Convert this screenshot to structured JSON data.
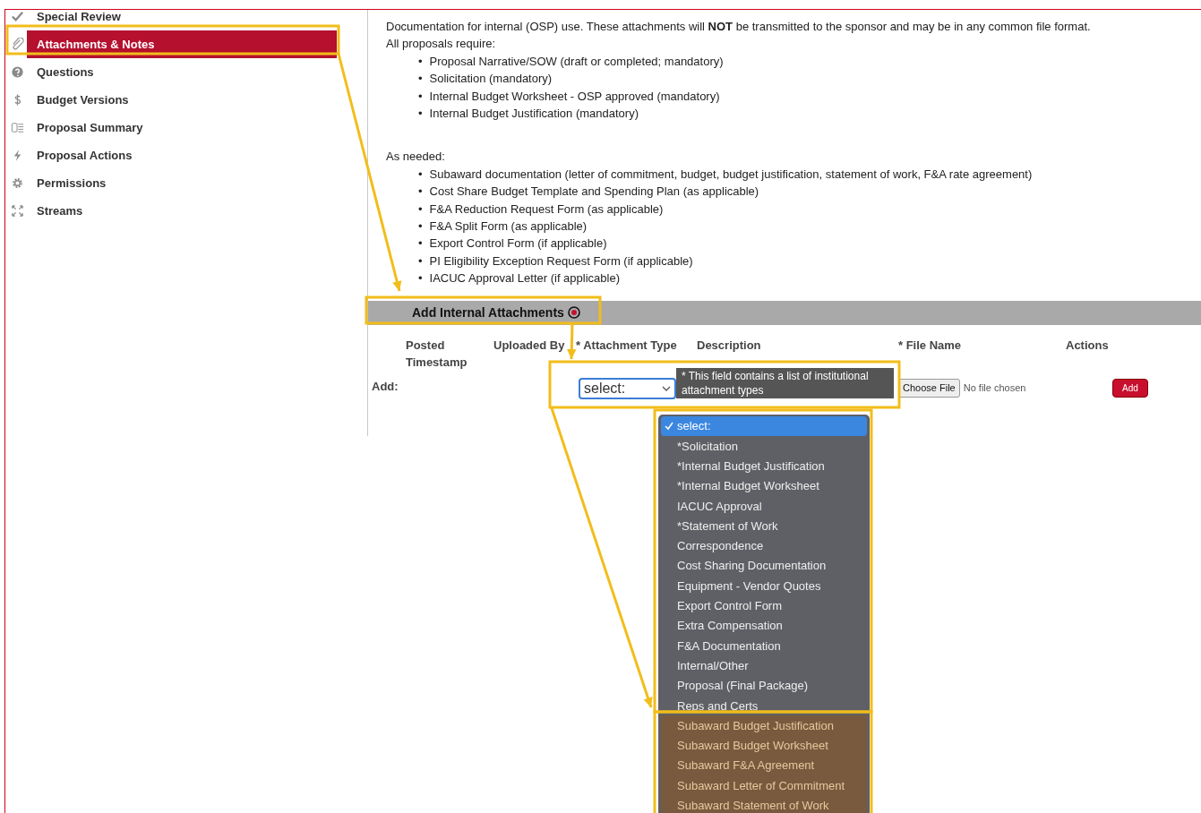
{
  "sidebar": {
    "items": [
      {
        "label": "Special Review",
        "selected": false
      },
      {
        "label": "Attachments & Notes",
        "selected": true
      },
      {
        "label": "Questions",
        "selected": false
      },
      {
        "label": "Budget Versions",
        "selected": false
      },
      {
        "label": "Proposal Summary",
        "selected": false
      },
      {
        "label": "Proposal Actions",
        "selected": false
      },
      {
        "label": "Permissions",
        "selected": false
      },
      {
        "label": "Streams",
        "selected": false
      }
    ]
  },
  "intro": {
    "text": "Documentation for internal (OSP) use. These attachments will **NOT** be transmitted to the sponsor and may be in any common file format.",
    "required_heading": "All proposals require:",
    "required": [
      {
        "bullet": "•",
        "text": "Proposal Narrative/SOW (draft or completed; mandatory)"
      },
      {
        "bullet": "•",
        "text": "Solicitation (mandatory)"
      },
      {
        "bullet": "•",
        "text": "Internal Budget Worksheet - OSP approved (mandatory)"
      },
      {
        "bullet": "•",
        "text": "Internal Budget Justification (mandatory)"
      }
    ],
    "needed_heading": "As needed:",
    "needed": [
      {
        "bullet": "•",
        "text": "Subaward documentation (letter of commitment, budget, budget justification, statement of work, F&A rate agreement)"
      },
      {
        "bullet": "•",
        "text": "Cost Share Budget Template and Spending Plan (as applicable)"
      },
      {
        "bullet": "•",
        "text": "F&A Reduction Request Form (as applicable)"
      },
      {
        "bullet": "•",
        "text": "F&A Split Form (as applicable)"
      },
      {
        "bullet": "•",
        "text": "Export Control Form (if applicable)"
      },
      {
        "bullet": "•",
        "text": "PI Eligibility Exception Request Form (if applicable)"
      },
      {
        "bullet": "•",
        "text": "IACUC Approval Letter (if applicable)"
      }
    ]
  },
  "section": {
    "title": "Add Internal Attachments"
  },
  "table": {
    "columns": [
      "Posted Timestamp",
      "Uploaded By",
      "* Attachment Type",
      "Description",
      "* File Name",
      "Actions"
    ],
    "add_row": {
      "label": "Add:",
      "attachment_type": "select:",
      "file_button": "Choose File",
      "file_status": "No file chosen",
      "add_button": "Add"
    }
  },
  "tooltip": "* This field contains a list of institutional attachment types",
  "dropdown": {
    "options": [
      {
        "label": "select:",
        "selected": true,
        "highlighted": false
      },
      {
        "label": "*Solicitation",
        "selected": false,
        "highlighted": false
      },
      {
        "label": "*Internal Budget Justification",
        "selected": false,
        "highlighted": false
      },
      {
        "label": "*Internal Budget Worksheet",
        "selected": false,
        "highlighted": false
      },
      {
        "label": "IACUC Approval",
        "selected": false,
        "highlighted": false
      },
      {
        "label": "*Statement of Work",
        "selected": false,
        "highlighted": false
      },
      {
        "label": "Correspondence",
        "selected": false,
        "highlighted": false
      },
      {
        "label": "Cost Sharing Documentation",
        "selected": false,
        "highlighted": false
      },
      {
        "label": "Equipment - Vendor Quotes",
        "selected": false,
        "highlighted": false
      },
      {
        "label": "Export Control Form",
        "selected": false,
        "highlighted": false
      },
      {
        "label": "Extra Compensation",
        "selected": false,
        "highlighted": false
      },
      {
        "label": "F&A Documentation",
        "selected": false,
        "highlighted": false
      },
      {
        "label": "Internal/Other",
        "selected": false,
        "highlighted": false
      },
      {
        "label": "Proposal (Final Package)",
        "selected": false,
        "highlighted": false
      },
      {
        "label": "Reps and Certs",
        "selected": false,
        "highlighted": false
      },
      {
        "label": "Subaward Budget Justification",
        "selected": false,
        "highlighted": true
      },
      {
        "label": "Subaward Budget Worksheet",
        "selected": false,
        "highlighted": true
      },
      {
        "label": "Subaward F&A Agreement",
        "selected": false,
        "highlighted": true
      },
      {
        "label": "Subaward Letter of Commitment",
        "selected": false,
        "highlighted": true
      },
      {
        "label": "Subaward Statement of Work",
        "selected": false,
        "highlighted": true
      }
    ]
  }
}
